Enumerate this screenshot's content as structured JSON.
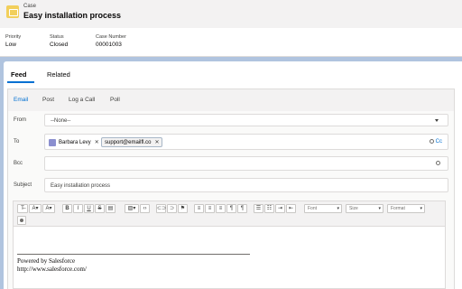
{
  "header": {
    "record_type": "Case",
    "title": "Easy installation process",
    "fields": [
      {
        "label": "Priority",
        "value": "Low"
      },
      {
        "label": "Status",
        "value": "Closed"
      },
      {
        "label": "Case Number",
        "value": "00001003"
      }
    ]
  },
  "tabs": {
    "feed": "Feed",
    "related": "Related"
  },
  "publisher": {
    "tabs": [
      "Email",
      "Post",
      "Log a Call",
      "Poll"
    ],
    "from_label": "From",
    "from_value": "--None--",
    "to_label": "To",
    "to_recipients": [
      "Barbara Levy",
      "support@emailfl.co"
    ],
    "cc_label": "Cc",
    "bcc_label": "Bcc",
    "subject_label": "Subject",
    "subject_value": "Easy installation process"
  },
  "toolbar": {
    "font_dropdown": "Font",
    "size_dropdown": "Size",
    "format_dropdown": "Format"
  },
  "signature": {
    "line1": "Powered by Salesforce",
    "line2": "http://www.salesforce.com/"
  },
  "colors": {
    "accent": "#0070d2",
    "case_icon": "#f2cf5b",
    "background": "#b0c4df"
  }
}
